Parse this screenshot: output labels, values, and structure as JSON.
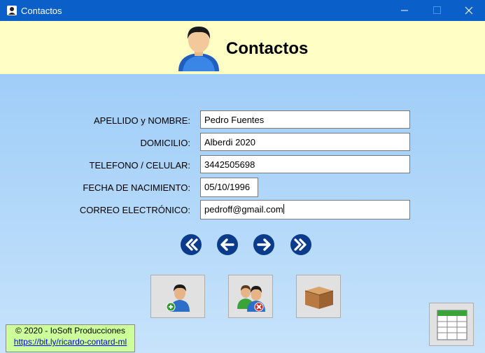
{
  "window": {
    "title": "Contactos"
  },
  "header": {
    "heading": "Contactos"
  },
  "form": {
    "fields": [
      {
        "label": "APELLIDO y NOMBRE:",
        "value": "Pedro Fuentes"
      },
      {
        "label": "DOMICILIO:",
        "value": "Alberdi 2020"
      },
      {
        "label": "TELEFONO / CELULAR:",
        "value": "3442505698"
      },
      {
        "label": "FECHA DE NACIMIENTO:",
        "value": "05/10/1996"
      },
      {
        "label": "CORREO ELECTRÓNICO:",
        "value": "pedroff@gmail.com"
      }
    ]
  },
  "navigation": {
    "icons": [
      "first-record-icon",
      "previous-record-icon",
      "next-record-icon",
      "last-record-icon"
    ]
  },
  "actions": {
    "icons": [
      "add-contact-icon",
      "delete-contact-icon",
      "archive-box-icon",
      "spreadsheet-icon"
    ]
  },
  "credit": {
    "copyright": "© 2020 - IoSoft Producciones",
    "link": "https://bit.ly/ricardo-contard-ml"
  },
  "colors": {
    "titlebar": "#0a5fc9",
    "header": "#fffec5",
    "background": "#9fcdf8",
    "credit": "#ccff99",
    "nav": "#0b3c8c"
  }
}
